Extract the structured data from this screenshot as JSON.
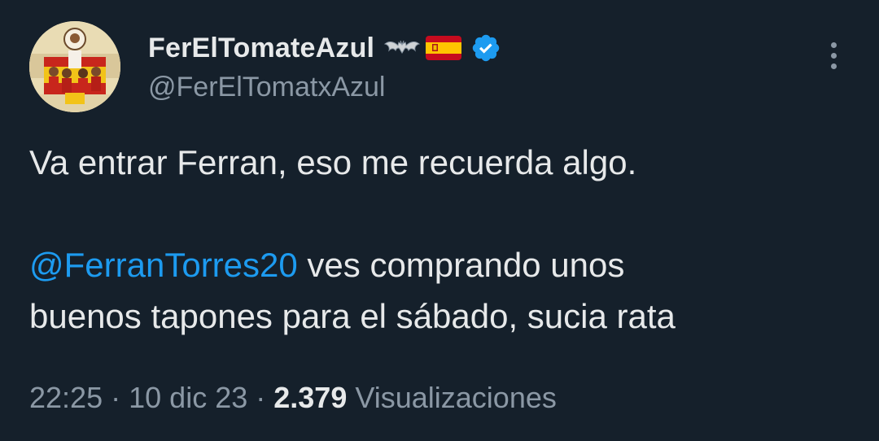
{
  "author": {
    "display_name": "FerElTomateAzul",
    "handle": "@FerElTomatxAzul",
    "name_emojis": [
      "bat-emoji",
      "spain-flag-emoji"
    ],
    "verified": true
  },
  "tweet": {
    "line1": "Va entrar Ferran, eso me recuerda algo.",
    "mention": "@FerranTorres20",
    "line2_rest": " ves comprando unos",
    "line3": "buenos tapones para el sábado, sucia rata"
  },
  "meta": {
    "time": "22:25",
    "separator": "·",
    "date": "10 dic 23",
    "views_count": "2.379",
    "views_label": "Visualizaciones"
  },
  "colors": {
    "background": "#15202b",
    "text": "#e7e9ea",
    "secondary": "#8b98a5",
    "link": "#1d9bf0",
    "verified": "#1d9bf0"
  }
}
